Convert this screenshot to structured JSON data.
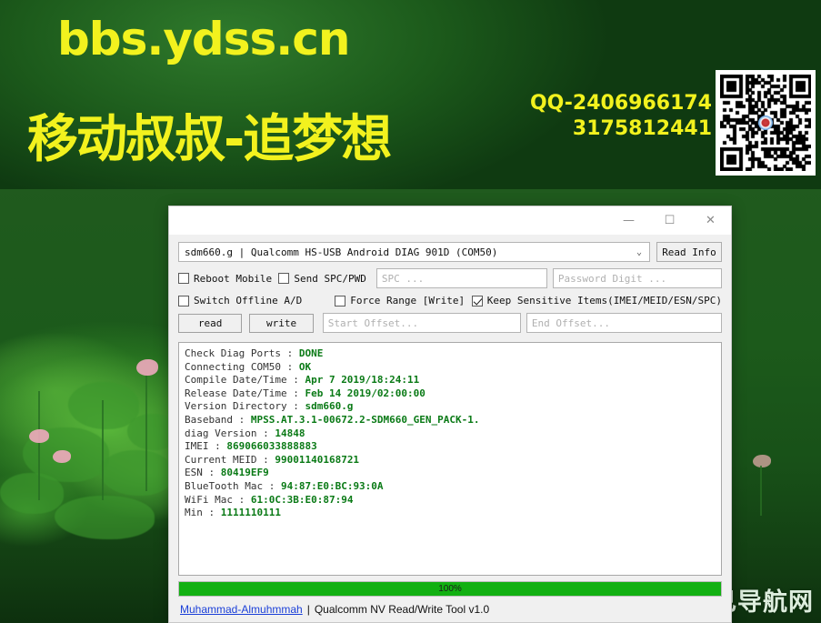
{
  "banner": {
    "url": "bbs.ydss.cn",
    "tagline": "移动叔叔-追梦想",
    "qq_line1": "QQ-2406966174",
    "qq_line2": "3175812441",
    "qr_alt": "qr-code"
  },
  "watermark": {
    "bottom_right": "妲己导航网"
  },
  "window": {
    "title": "",
    "title_ghost": "",
    "controls": {
      "minimize": "—",
      "maximize": "☐",
      "close": "✕"
    }
  },
  "toolbar": {
    "port_value": "sdm660.g | Qualcomm HS-USB Android DIAG 901D (COM50)",
    "port_caret": "⌄",
    "read_info_label": "Read Info"
  },
  "options": {
    "reboot_mobile": {
      "label": "Reboot Mobile",
      "checked": false
    },
    "send_spc_pwd": {
      "label": "Send SPC/PWD",
      "checked": false
    },
    "switch_offline": {
      "label": "Switch Offline A/D",
      "checked": false
    },
    "force_range": {
      "label": "Force Range [Write]",
      "checked": false
    },
    "keep_sensitive": {
      "label": "Keep Sensitive Items(IMEI/MEID/ESN/SPC)",
      "checked": true
    }
  },
  "fields": {
    "spc_placeholder": "SPC ...",
    "spc_value": "",
    "password_placeholder": "Password Digit ...",
    "password_value": "",
    "start_offset_placeholder": "Start Offset...",
    "start_offset_value": "",
    "end_offset_placeholder": "End Offset...",
    "end_offset_value": ""
  },
  "actions": {
    "read_label": "read",
    "write_label": "write"
  },
  "log": [
    {
      "label": "Check Diag Ports : ",
      "value": "DONE"
    },
    {
      "label": "Connecting COM50 : ",
      "value": "OK"
    },
    {
      "label": "Compile Date/Time : ",
      "value": "Apr  7 2019/18:24:11"
    },
    {
      "label": "Release Date/Time : ",
      "value": "Feb 14 2019/02:00:00"
    },
    {
      "label": "Version Directory : ",
      "value": "sdm660.g"
    },
    {
      "label": "Baseband : ",
      "value": "MPSS.AT.3.1-00672.2-SDM660_GEN_PACK-1."
    },
    {
      "label": "diag Version : ",
      "value": "14848"
    },
    {
      "label": "IMEI : ",
      "value": "869066033888883"
    },
    {
      "label": "Current MEID : ",
      "value": "99001140168721"
    },
    {
      "label": "ESN : ",
      "value": "80419EF9"
    },
    {
      "label": "BlueTooth Mac : ",
      "value": "94:87:E0:BC:93:0A"
    },
    {
      "label": "WiFi Mac : ",
      "value": "61:0C:3B:E0:87:94"
    },
    {
      "label": "Min : ",
      "value": "1111110111"
    }
  ],
  "progress": {
    "percent": 100,
    "label": "100%",
    "fill_color": "#12b012"
  },
  "footer": {
    "author_link": "Muhammad-Almuhmmah",
    "separator": "|",
    "app_name": "Qualcomm NV Read/Write Tool v1.0"
  }
}
